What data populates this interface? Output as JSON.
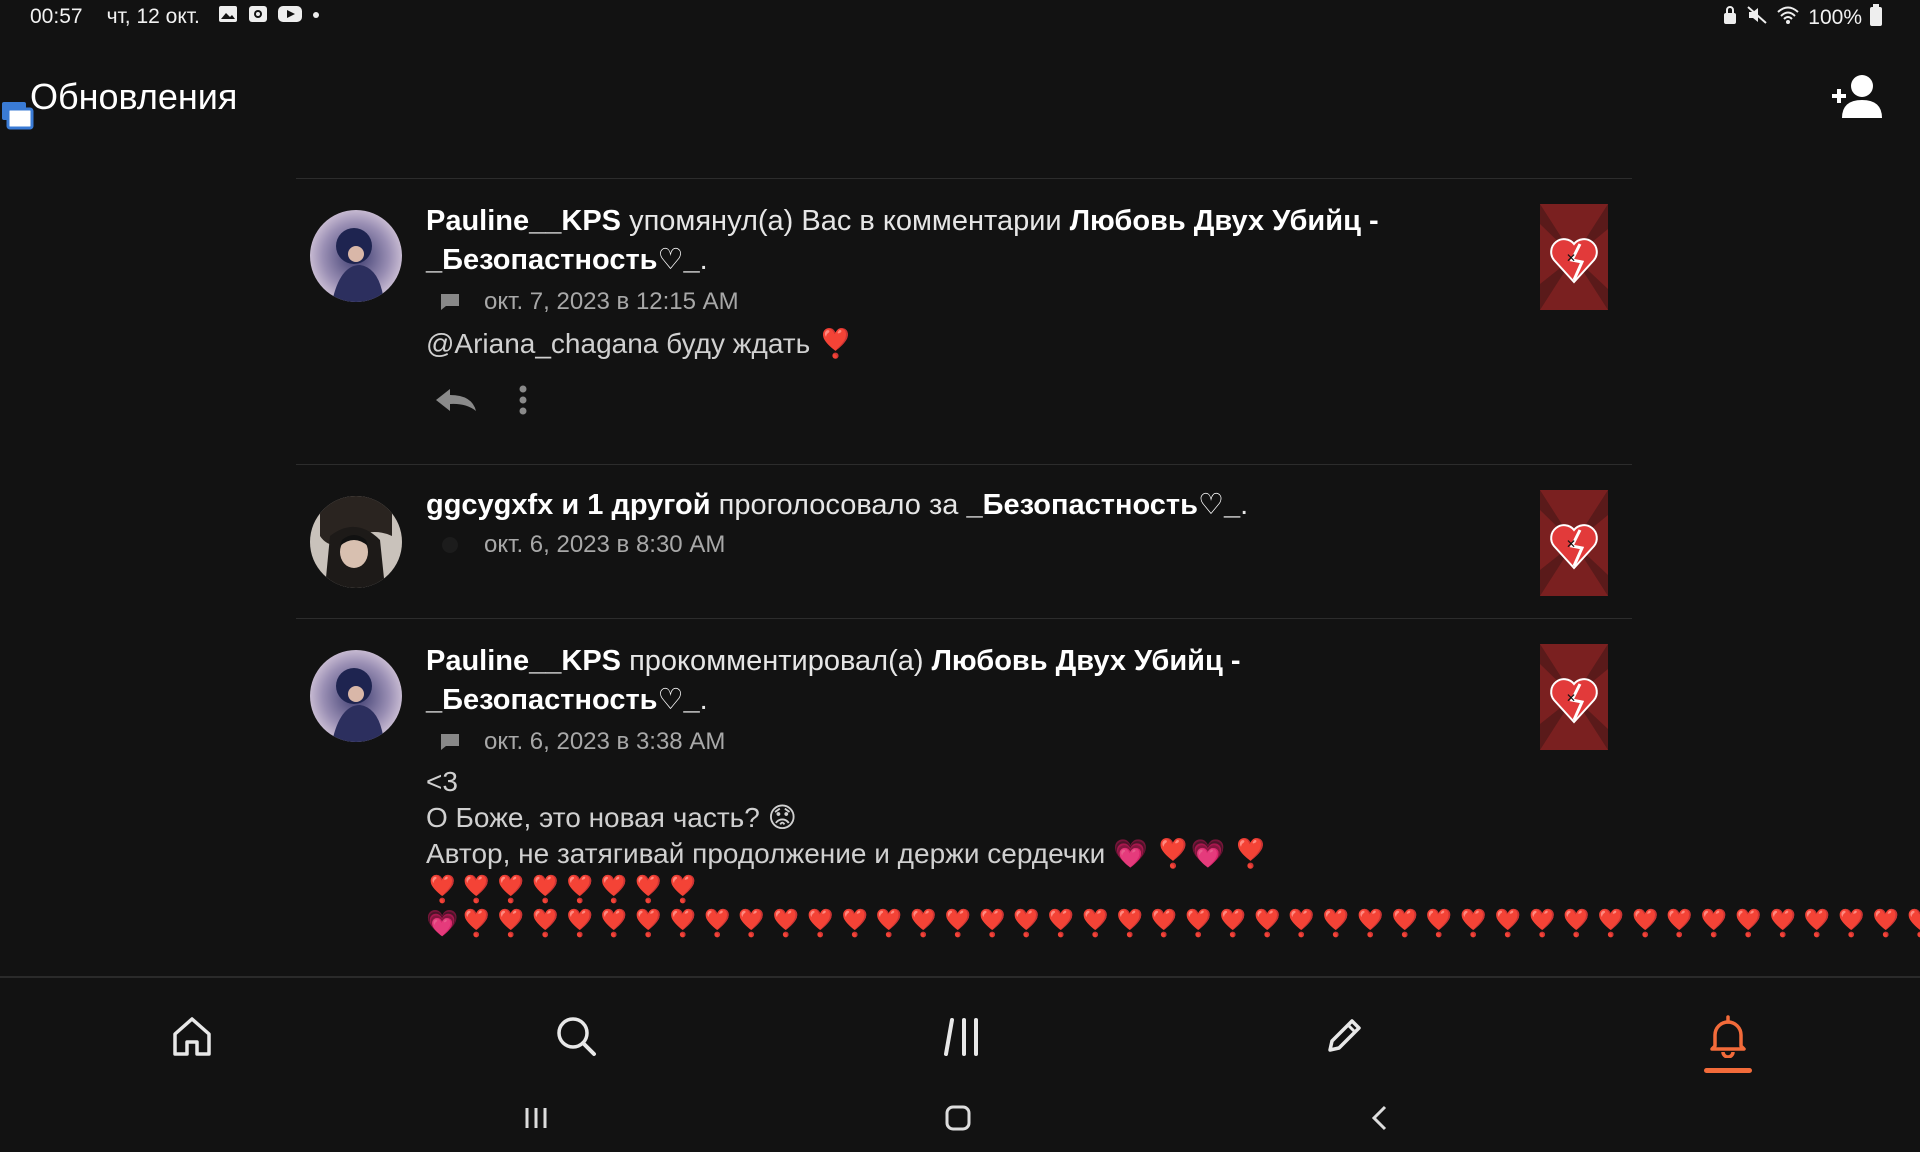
{
  "status_bar": {
    "time": "00:57",
    "date": "чт, 12 окт.",
    "battery": "100%",
    "left_icons": [
      "gallery-icon",
      "camera-icon",
      "youtube-icon",
      "dot-icon"
    ],
    "right_icons": [
      "lock-icon",
      "mute-icon",
      "wifi-icon",
      "battery-icon"
    ]
  },
  "header": {
    "title": "Обновления",
    "action_icon": "add-user-icon"
  },
  "notifications": [
    {
      "user": "Pauline__KPS",
      "action": " упомянул(а) Вас в комментарии ",
      "target": "Любовь Двух Убийц - _Безопастность♡_",
      "end": ".",
      "meta_icon": "comment-icon",
      "time": "окт. 7, 2023 в 12:15 AM",
      "body": "@Ariana_chagana буду ждать ❣️",
      "actions": [
        "reply-icon",
        "more-icon"
      ]
    },
    {
      "user": "ggcygxfx и 1 другой",
      "action": " проголосовало за ",
      "target": "_Безопастность♡_",
      "end": ".",
      "meta_icon": "star-icon",
      "time": "окт. 6, 2023 в 8:30 AM"
    },
    {
      "user": "Pauline__KPS",
      "action": " прокомментировал(а) ",
      "target": "Любовь Двух Убийц - _Безопастность♡_",
      "end": ".",
      "meta_icon": "comment-icon",
      "time": "окт. 6, 2023 в 3:38 AM",
      "body": "<3\nО Боже, это новая часть? 😟\nАвтор, не затягивай продолжение и держи сердечки 💗 ❣️💗 ❣️",
      "hearts": "❣️❣️❣️❣️❣️❣️❣️❣️💗❣️❣️❣️❣️❣️❣️❣️❣️❣️❣️❣️❣️❣️❣️❣️❣️❣️❣️❣️❣️❣️❣️❣️❣️❣️❣️❣️❣️❣️❣️❣️❣️❣️❣️❣️❣️❣️❣️❣️❣️❣️❣️❣️"
    }
  ],
  "bottom_nav": {
    "items": [
      "home-icon",
      "search-icon",
      "library-icon",
      "write-icon",
      "notifications-icon"
    ],
    "active": "notifications-icon",
    "accent": "#f36b3a"
  },
  "system_nav": [
    "recents-button",
    "home-button",
    "back-button"
  ]
}
